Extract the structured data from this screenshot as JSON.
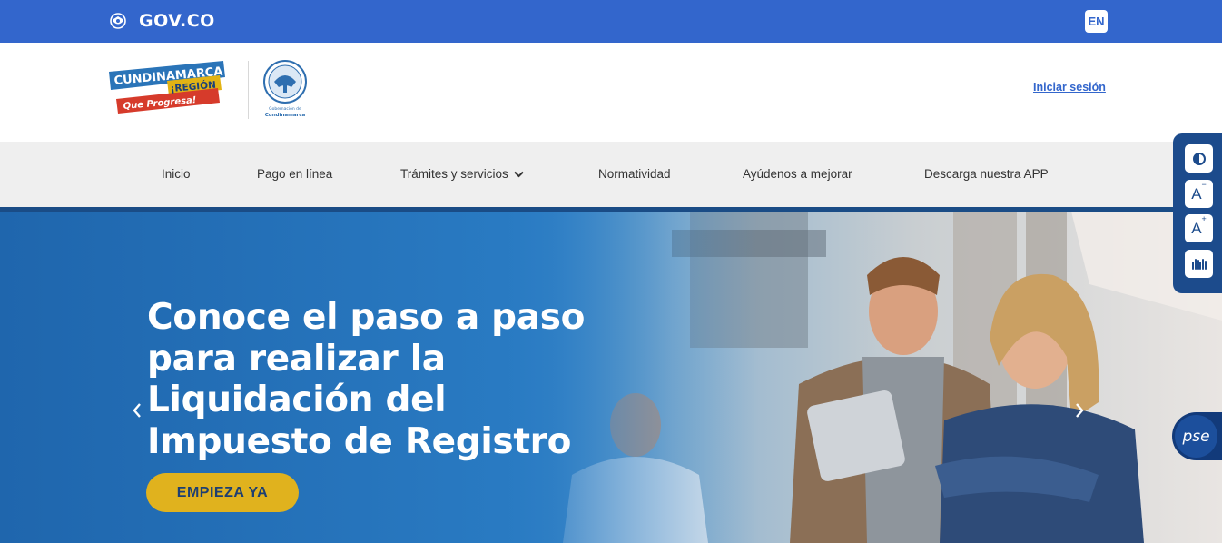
{
  "govbar": {
    "logo_text": "GOV.CO",
    "lang_button": "EN",
    "colors": {
      "bar": "#3366cc",
      "accent": "#f3b500"
    }
  },
  "header": {
    "brand": {
      "line1": "CUNDINAMARCA",
      "line2": "¡REGIÓN",
      "line3": "Que Progresa!"
    },
    "seal_caption_1": "Gobernación de",
    "seal_caption_2": "Cundinamarca",
    "login_label": "Iniciar sesión"
  },
  "nav": {
    "items": [
      {
        "label": "Inicio"
      },
      {
        "label": "Pago en línea"
      },
      {
        "label": "Trámites y servicios",
        "has_dropdown": true
      },
      {
        "label": "Normatividad"
      },
      {
        "label": "Ayúdenos a mejorar"
      },
      {
        "label": "Descarga nuestra APP"
      }
    ]
  },
  "hero": {
    "title_lines": [
      "Conoce el paso a paso",
      "para realizar la",
      "Liquidación del",
      "Impuesto de Registro"
    ],
    "cta_label": "EMPIEZA YA",
    "prev_icon": "chevron-left-icon",
    "next_icon": "chevron-right-icon",
    "colors": {
      "cta": "#e0b21e",
      "base": "#1f65a8"
    }
  },
  "accessibility": {
    "buttons": [
      {
        "icon": "contrast-icon",
        "label": ""
      },
      {
        "icon": "decrease-font-icon",
        "label": "A",
        "sup": "−"
      },
      {
        "icon": "increase-font-icon",
        "label": "A",
        "sup": "+"
      },
      {
        "icon": "sign-language-icon",
        "label": ""
      }
    ]
  },
  "pse": {
    "label": "pse"
  }
}
